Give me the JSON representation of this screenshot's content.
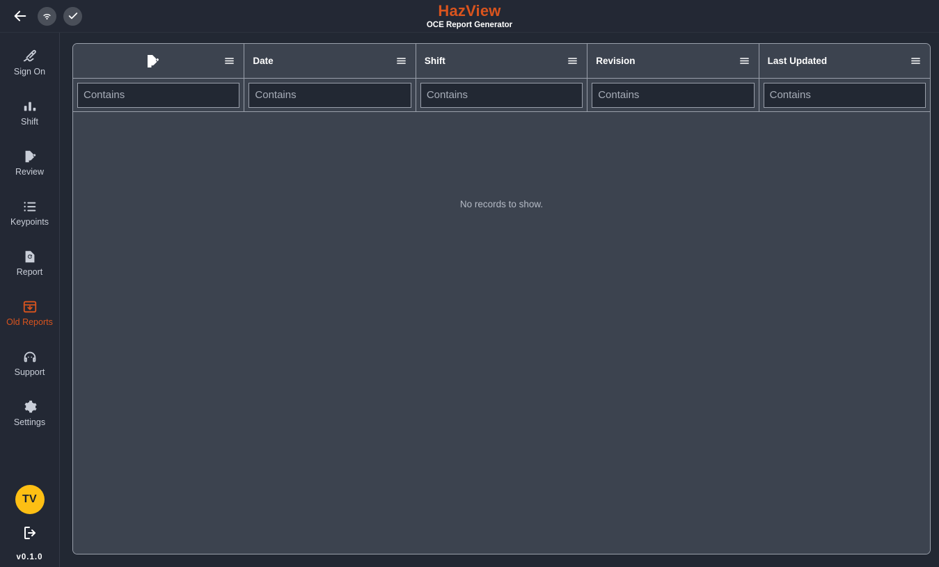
{
  "topbar": {
    "back_icon": "arrow-left-icon",
    "wifi_icon": "wifi-icon",
    "check_icon": "check-icon",
    "title": "HazView",
    "subtitle": "OCE Report Generator"
  },
  "sidebar": {
    "items": [
      {
        "label": "Sign On",
        "icon": "signature-icon",
        "active": false
      },
      {
        "label": "Shift",
        "icon": "bar-chart-icon",
        "active": false
      },
      {
        "label": "Review",
        "icon": "document-edit-icon",
        "active": false
      },
      {
        "label": "Keypoints",
        "icon": "list-icon",
        "active": false
      },
      {
        "label": "Report",
        "icon": "document-restore-icon",
        "active": false
      },
      {
        "label": "Old Reports",
        "icon": "archive-download-icon",
        "active": true
      },
      {
        "label": "Support",
        "icon": "support-agent-icon",
        "active": false
      },
      {
        "label": "Settings",
        "icon": "gear-icon",
        "active": false
      }
    ],
    "avatar_initials": "TV",
    "logout_icon": "logout-icon",
    "version": "v0.1.0"
  },
  "grid": {
    "columns": [
      {
        "label": "",
        "icon": "document-edit-icon",
        "menu_icon": "hamburger-menu-icon",
        "filter_placeholder": "Contains",
        "filter_value": ""
      },
      {
        "label": "Date",
        "icon": null,
        "menu_icon": "hamburger-menu-icon",
        "filter_placeholder": "Contains",
        "filter_value": ""
      },
      {
        "label": "Shift",
        "icon": null,
        "menu_icon": "hamburger-menu-icon",
        "filter_placeholder": "Contains",
        "filter_value": ""
      },
      {
        "label": "Revision",
        "icon": null,
        "menu_icon": "hamburger-menu-icon",
        "filter_placeholder": "Contains",
        "filter_value": ""
      },
      {
        "label": "Last Updated",
        "icon": null,
        "menu_icon": "hamburger-menu-icon",
        "filter_placeholder": "Contains",
        "filter_value": ""
      }
    ],
    "rows": [],
    "empty_message": "No records to show."
  },
  "colors": {
    "accent": "#D9541E",
    "avatar": "#FDBF14",
    "page_bg": "#222833",
    "panel_bg": "#232834",
    "grid_bg": "#3C434F",
    "grid_border": "#9AA0AB"
  }
}
